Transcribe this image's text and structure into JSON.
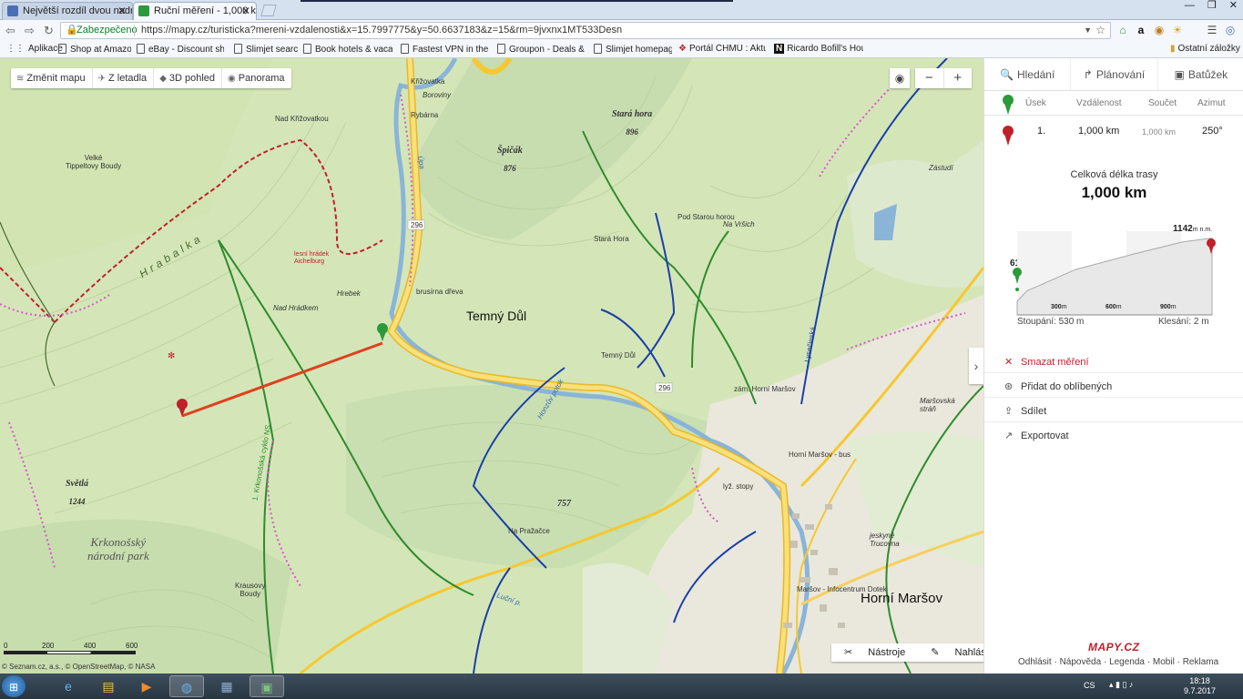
{
  "browser": {
    "tabs": [
      {
        "title": "Největší rozdíl dvou nadm",
        "active": false,
        "favicon_color": "#4a6fb5"
      },
      {
        "title": "Ruční měření - 1,000 km",
        "active": true,
        "favicon_color": "#2a9a3b"
      }
    ],
    "window_controls": [
      "—",
      "❐",
      "✕"
    ],
    "address": {
      "secure_label": "Zabezpečeno",
      "url": "https://mapy.cz/turisticka?mereni-vzdalenosti&x=15.7997775&y=50.6637183&z=15&rm=9jvxnx1MT533Desn"
    },
    "bookmarks": [
      {
        "label": "Aplikace",
        "icon": "apps-grid-icon"
      },
      {
        "label": "Shop at Amazon",
        "icon": "page-icon"
      },
      {
        "label": "eBay - Discount shop",
        "icon": "page-icon"
      },
      {
        "label": "Slimjet search",
        "icon": "page-icon"
      },
      {
        "label": "Book hotels & vacatic",
        "icon": "page-icon"
      },
      {
        "label": "Fastest VPN in the wo",
        "icon": "page-icon"
      },
      {
        "label": "Groupon - Deals & Cc",
        "icon": "page-icon"
      },
      {
        "label": "Slimjet homepage",
        "icon": "page-icon"
      },
      {
        "label": "Portál ČHMÚ : Aktuál",
        "icon": "chmu-icon"
      },
      {
        "label": "Ricardo Bofill's House",
        "icon": "n-icon"
      }
    ],
    "other_bookmarks": "Ostatní záložky"
  },
  "map": {
    "toolbar": [
      {
        "label": "Změnit mapu",
        "icon": "layers-icon"
      },
      {
        "label": "Z letadla",
        "icon": "plane-icon"
      },
      {
        "label": "3D pohled",
        "icon": "cube-icon"
      },
      {
        "label": "Panorama",
        "icon": "eye-icon"
      }
    ],
    "zoom_out": "−",
    "zoom_in": "+",
    "labels": {
      "temny_dul": "Temný Důl",
      "horni_marsov": "Horní Maršov",
      "park": "Krkonošský\nnárodní park",
      "kriz": "Křižovatka",
      "borviny": "Boroviny",
      "rybarna": "Rybárna",
      "nad_krizovatkou": "Nad Křižovatkou",
      "velke_tipeltovy": "Velké\nTippeltovy Boudy",
      "hrebek": "Hrebek",
      "nad_hradkem": "Nad Hrádkem",
      "lesni_hradek": "lesní hrádek\nAichelburg",
      "brusirna": "brusírna dřeva",
      "stara_hora_lbl": "Stará Hora",
      "pod_starou": "Pod Starou horou",
      "na_vrsich": "Na Vršich",
      "temny_dul_stop": "Temný Důl",
      "zam_horni": "zám. Horní Maršov",
      "horni_bus": "Horní Maršov - bus",
      "lyz_stopy": "lyž. stopy",
      "na_prazacce": "Na Pražačce",
      "krausovy": "Krausovy\nBoudy",
      "marsovska": "Maršovská\nstráň",
      "zastudi": "Zástudí",
      "jeskyne": "jeskyně\nTrucovna",
      "infocentrum": "Maršov - Infocentrum Dotek",
      "hrabalka": "Hrabalka",
      "lucni_p": "Luční p.",
      "hranicni": "Honzův potok",
      "krk_cyklo": "1. Krkonošská cyklo NS",
      "lysecinska": "Lysečinská",
      "upa": "Úpa"
    },
    "peaks": [
      {
        "name": "Stará hora",
        "alt": "896"
      },
      {
        "name": "Špičák",
        "alt": "876"
      },
      {
        "name": "Světlá",
        "alt": "1244"
      },
      {
        "name": "",
        "alt": "757"
      }
    ],
    "road_numbers": [
      "296",
      "296"
    ],
    "tools": [
      {
        "label": "Nástroje",
        "icon": "tools-icon"
      },
      {
        "label": "Nahlásit chybu",
        "icon": "pencil-icon"
      }
    ],
    "scale": {
      "ticks": [
        "0",
        "200",
        "400",
        "600"
      ],
      "unit": "m"
    },
    "copyright": "© Seznam.cz, a.s., © OpenStreetMap, © NASA",
    "panel_toggle": "›"
  },
  "panel": {
    "tabs": [
      {
        "label": "Hledání",
        "icon": "search-icon"
      },
      {
        "label": "Plánování",
        "icon": "route-icon"
      },
      {
        "label": "Batůžek",
        "icon": "backpack-icon"
      }
    ],
    "table": {
      "headers": [
        "Úsek",
        "Vzdálenost",
        "Součet",
        "Azimut"
      ],
      "rows": [
        {
          "segment": "1.",
          "distance": "1,000 km",
          "sum": "1,000 km",
          "azimuth": "250°"
        }
      ]
    },
    "total_label": "Celková délka trasy",
    "total_value": "1,000 km",
    "elevation": {
      "start": "614",
      "end": "1142",
      "unit": "m n.m.",
      "ticks": [
        "300",
        "600",
        "900"
      ],
      "tick_unit": "m",
      "ascent": "Stoupání: 530 m",
      "descent": "Klesání: 2 m",
      "profile": [
        [
          0,
          614
        ],
        [
          0.05,
          700
        ],
        [
          0.3,
          880
        ],
        [
          0.6,
          1010
        ],
        [
          0.85,
          1110
        ],
        [
          1.0,
          1142
        ]
      ]
    },
    "actions": [
      {
        "label": "Smazat měření",
        "icon": "✕",
        "color": "#c0202a"
      },
      {
        "label": "Přidat do oblíbených",
        "icon": "⊛",
        "color": "#333"
      },
      {
        "label": "Sdílet",
        "icon": "⇪",
        "color": "#333"
      },
      {
        "label": "Exportovat",
        "icon": "↗",
        "color": "#333"
      }
    ],
    "logo": "MAPY.CZ",
    "footer": [
      "Odhlásit",
      "Nápověda",
      "Legenda",
      "Mobil",
      "Reklama"
    ]
  },
  "taskbar": {
    "lang": "CS",
    "time": "18:18",
    "date": "9.7.2017"
  },
  "colors": {
    "measure_line": "#e0401e",
    "road_yellow": "#f5c832",
    "river": "#8ab4d8",
    "trail_green": "#2e8b2e",
    "trail_blue": "#1a3fa8",
    "trail_red": "#c0202a",
    "pink_marker": "#d45ac8"
  }
}
